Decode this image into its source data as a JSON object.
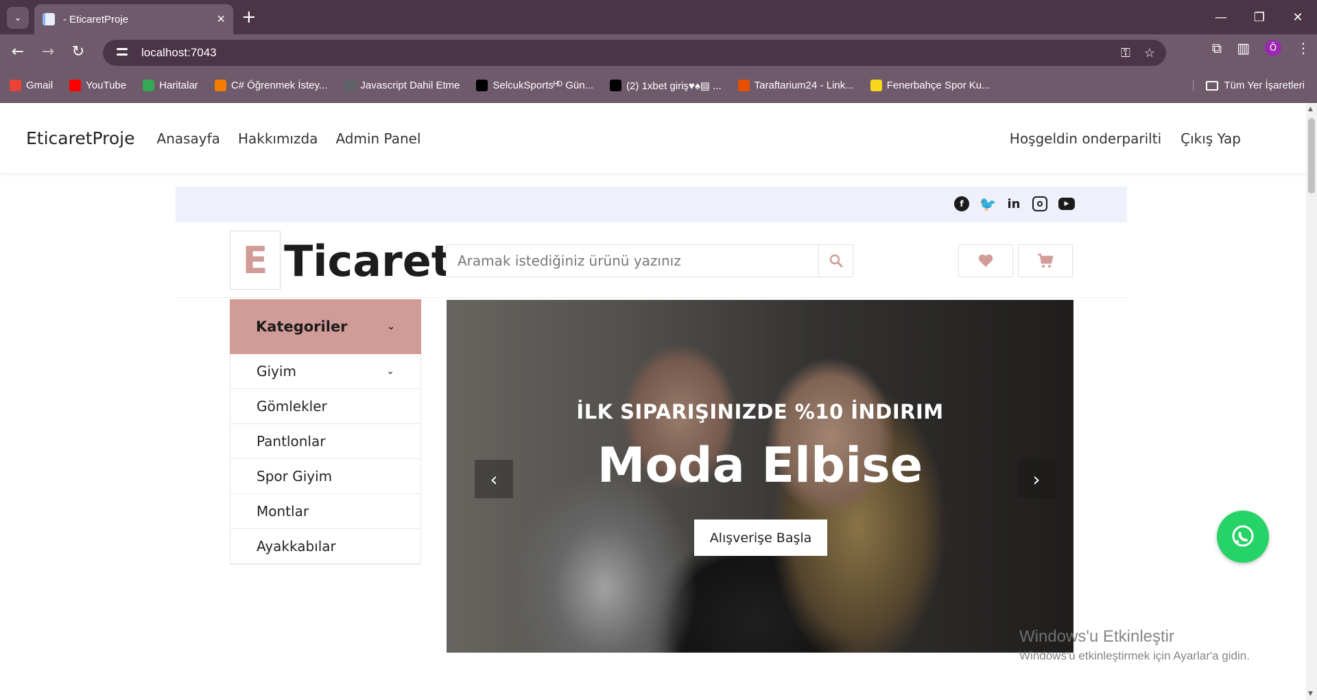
{
  "browser": {
    "tab_title": "- EticaretProje",
    "new_tab": "+",
    "url": "localhost:7043",
    "bookmarks": [
      {
        "label": "Gmail",
        "icon": "gmail-icon",
        "color": "#ea4335"
      },
      {
        "label": "YouTube",
        "icon": "youtube-icon",
        "color": "#ff0000"
      },
      {
        "label": "Haritalar",
        "icon": "maps-icon",
        "color": "#34a853"
      },
      {
        "label": "C# Öğrenmek İstey...",
        "icon": "blogger-icon",
        "color": "#f57c00"
      },
      {
        "label": "Javascript Dahil Etme",
        "icon": "globe-icon",
        "color": "#5f6368"
      },
      {
        "label": "SelcukSportsᴴᴰ Gün...",
        "icon": "x-icon",
        "color": "#000000"
      },
      {
        "label": "(2) 1xbet giriş♥♠▤ ...",
        "icon": "x-icon",
        "color": "#000000"
      },
      {
        "label": "Taraftarium24 - Link...",
        "icon": "taraftarium-icon",
        "color": "#e65100"
      },
      {
        "label": "Fenerbahçe Spor Ku...",
        "icon": "fenerbahce-icon",
        "color": "#f9d71c"
      }
    ],
    "all_bookmarks": "Tüm Yer İşaretleri",
    "profile_initial": "Ö"
  },
  "nav": {
    "brand": "EticaretProje",
    "links": [
      "Anasayfa",
      "Hakkımızda",
      "Admin Panel"
    ],
    "welcome": "Hoşgeldin onderparilti",
    "logout": "Çıkış Yap"
  },
  "social": [
    "facebook-icon",
    "twitter-icon",
    "linkedin-icon",
    "instagram-icon",
    "youtube-icon"
  ],
  "logo": {
    "letter": "E",
    "text": "Ticaret",
    "accent": "#d19c97"
  },
  "search": {
    "placeholder": "Aramak istediğiniz ürünü yazınız"
  },
  "categories": {
    "header": "Kategoriler",
    "items": [
      "Giyim",
      "Gömlekler",
      "Pantlonlar",
      "Spor Giyim",
      "Montlar",
      "Ayakkabılar"
    ]
  },
  "carousel": {
    "subtitle": "İLK SIPARIŞINIZDE %10 İNDIRIM",
    "title": "Moda Elbise",
    "button": "Alışverişe Başla"
  },
  "windows_notice": {
    "title": "Windows'u Etkinleştir",
    "subtitle": "Windows'u etkinleştirmek için Ayarlar'a gidin."
  }
}
